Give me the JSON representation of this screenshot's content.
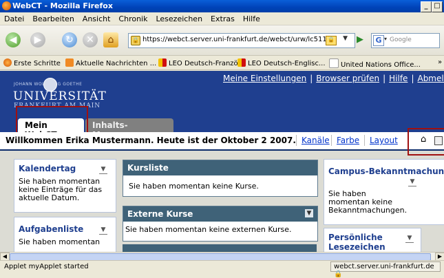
{
  "window": {
    "title": "WebCT - Mozilla Firefox"
  },
  "menu": [
    "Datei",
    "Bearbeiten",
    "Ansicht",
    "Chronik",
    "Lesezeichen",
    "Extras",
    "Hilfe"
  ],
  "nav": {
    "url": "https://webct.server.uni-frankfurt.de/webct/urw/lc511",
    "search_placeholder": "Google"
  },
  "bookmarks": [
    "Erste Schritte",
    "Aktuelle Nachrichten ...",
    "LEO Deutsch-Franzö...",
    "LEO Deutsch-Englisc...",
    "United Nations Office..."
  ],
  "header": {
    "uni_small": "JOHANN WOLFGANG GOETHE",
    "uni_name": "UNIVERSITÄT",
    "uni_city": "FRANKFURT AM MAIN",
    "links": [
      "Meine Einstellungen",
      "Browser prüfen",
      "Hilfe",
      "Abmelden"
    ],
    "link_separator": "|"
  },
  "tabs": [
    "Mein WebCT",
    "Inhalts-Manager"
  ],
  "welcome": {
    "text": "Willkommen Erika Mustermann. Heute ist der Oktober 2 2007.",
    "links": [
      "Kanäle",
      "Farbe",
      "Layout"
    ]
  },
  "panels": {
    "kalender": {
      "title": "Kalendertag",
      "body": "Sie haben momentan keine Einträge für das aktuelle Datum."
    },
    "aufgaben": {
      "title": "Aufgabenliste",
      "body": "Sie haben momentan"
    },
    "kursliste": {
      "title": "Kursliste",
      "body": "Sie haben momentan keine Kurse."
    },
    "externe": {
      "title": "Externe Kurse",
      "body": "Sie haben momentan keine externen Kurse."
    },
    "campus": {
      "title": "Campus-Bekanntmachungen",
      "body": "Sie haben momentan keine Bekanntmachungen."
    },
    "lesezeichen": {
      "title": "Persönliche Lesezeichen"
    }
  },
  "status": {
    "text": "Applet myApplet started",
    "host": "webct.server.uni-frankfurt.de"
  },
  "colors": {
    "header_blue": "#1f3f8f",
    "highlight_red": "#a01010",
    "panel_dark": "#3f6278"
  }
}
